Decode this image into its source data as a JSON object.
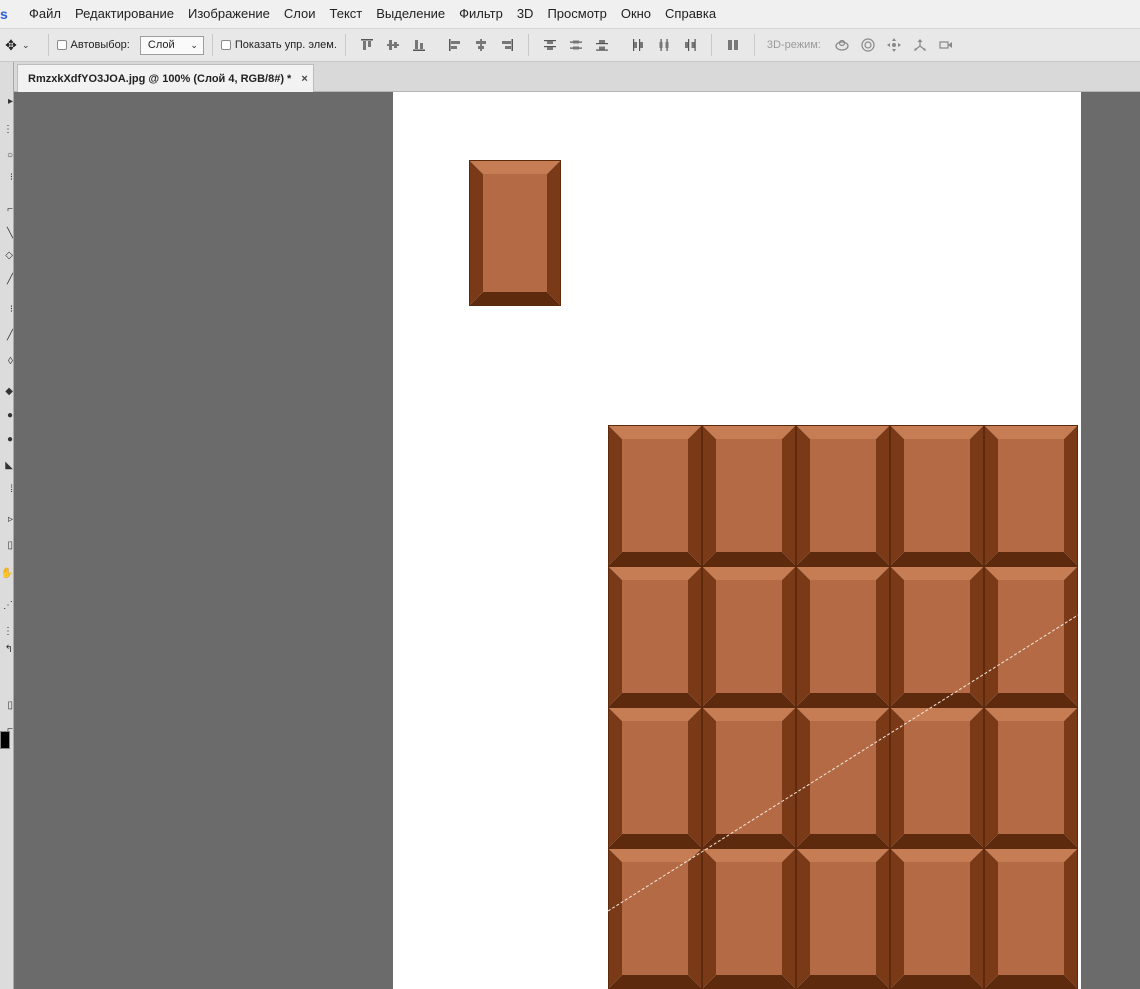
{
  "menu": {
    "logo": "s",
    "items": [
      "Файл",
      "Редактирование",
      "Изображение",
      "Слои",
      "Текст",
      "Выделение",
      "Фильтр",
      "3D",
      "Просмотр",
      "Окно",
      "Справка"
    ]
  },
  "options": {
    "autoselect_label": "Автовыбор:",
    "autoselect_checked": false,
    "target_value": "Слой",
    "show_controls_label": "Показать упр. элем.",
    "show_controls_checked": false,
    "mode_label": "3D-режим:",
    "align_icons": [
      "align-top-edges-icon",
      "align-vertical-centers-icon",
      "align-bottom-edges-icon",
      "align-left-edges-icon",
      "align-horizontal-centers-icon",
      "align-right-edges-icon"
    ],
    "distribute_icons": [
      "distribute-top-icon",
      "distribute-vertical-centers-icon",
      "distribute-bottom-icon",
      "distribute-left-icon",
      "distribute-horizontal-centers-icon",
      "distribute-right-icon"
    ],
    "mode_icons": [
      "rotate-3d-icon",
      "roll-3d-icon",
      "pan-3d-icon",
      "slide-3d-icon",
      "scale-3d-icon"
    ]
  },
  "document": {
    "tab_title": "RmzxkXdfYO3JOA.jpg @ 100% (Слой 4, RGB/8#) *",
    "close_glyph": "×"
  },
  "canvas": {
    "background": "#ffffff",
    "chocolate_colors": {
      "face": "#b46b45",
      "light": "#c77d54",
      "dark": "#7a3a17",
      "edge": "#5e2a0d"
    },
    "bar_rows": 4,
    "bar_cols": 5
  },
  "colors": {
    "menubar": "#f0f0f0",
    "workspace": "#6b6b6b",
    "foreground_swatch": "#000000"
  }
}
